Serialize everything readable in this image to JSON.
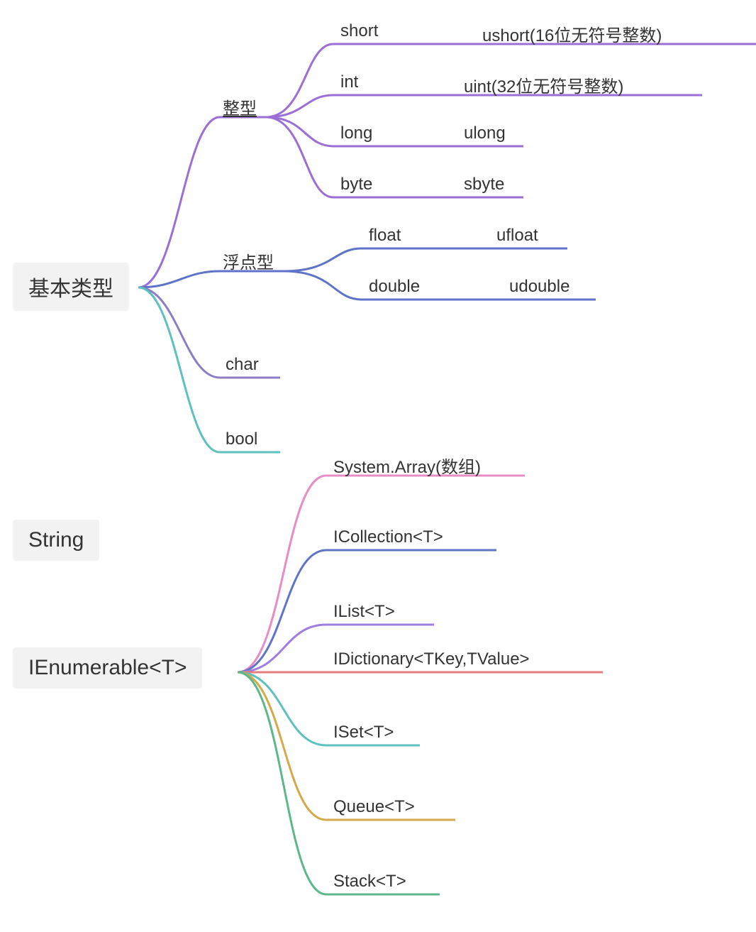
{
  "roots": {
    "basic": "基本类型",
    "string": "String",
    "ienum": "IEnumerable<T>"
  },
  "basic_children": {
    "integer": "整型",
    "float": "浮点型",
    "char": "char",
    "bool": "bool"
  },
  "integer_children": {
    "short": "short",
    "ushort": "ushort(16位无符号整数)",
    "int": "int",
    "uint": "uint(32位无符号整数)",
    "long": "long",
    "ulong": "ulong",
    "byte": "byte",
    "sbyte": "sbyte"
  },
  "float_children": {
    "float": "float",
    "ufloat": "ufloat",
    "double": "double",
    "udouble": "udouble"
  },
  "ienum_children": {
    "array": "System.Array(数组)",
    "icollection": "ICollection<T>",
    "ilist": "IList<T>",
    "idict": "IDictionary<TKey,TValue>",
    "iset": "ISet<T>",
    "queue": "Queue<T>",
    "stack": "Stack<T>"
  },
  "colors": {
    "purple": "#9b6fd6",
    "blue": "#5f74c9",
    "pink": "#e78cc4",
    "violet": "#a07de0",
    "red": "#e67e7e",
    "teal": "#5fc0c0",
    "gold": "#d6a84a",
    "green": "#5cb88a",
    "steel": "#6b8fb0"
  }
}
